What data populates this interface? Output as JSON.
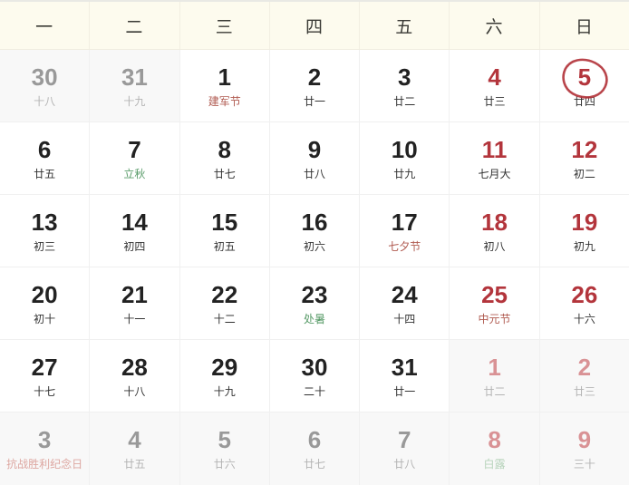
{
  "colors": {
    "header_bg": "#fdfbee",
    "cell_bg": "#ffffff",
    "other_month_bg": "#f8f8f8",
    "grid_line": "#f0f0f0",
    "number_default": "#222222",
    "number_weekend": "#b3353c",
    "number_other_month": "#999999",
    "number_other_month_weekend": "#d99295",
    "sub_default": "#333333",
    "sub_festival": "#b05a50",
    "sub_solar_term": "#5a9c6a",
    "marker_circle": "#b3353c"
  },
  "header": {
    "weekdays": [
      "一",
      "二",
      "三",
      "四",
      "五",
      "六",
      "日"
    ]
  },
  "marker": {
    "icon": "hand-drawn-circle-icon",
    "marked_day": "5",
    "color": "#b3353c"
  },
  "weeks": [
    {
      "days": [
        {
          "num": "30",
          "sub": "十八",
          "month": "other",
          "num_style": "muted",
          "sub_style": "muted",
          "marked": false
        },
        {
          "num": "31",
          "sub": "十九",
          "month": "other",
          "num_style": "muted",
          "sub_style": "muted",
          "marked": false
        },
        {
          "num": "1",
          "sub": "建军节",
          "month": "current",
          "num_style": "dark",
          "sub_style": "festival",
          "marked": false
        },
        {
          "num": "2",
          "sub": "廿一",
          "month": "current",
          "num_style": "dark",
          "sub_style": "normal",
          "marked": false
        },
        {
          "num": "3",
          "sub": "廿二",
          "month": "current",
          "num_style": "dark",
          "sub_style": "normal",
          "marked": false
        },
        {
          "num": "4",
          "sub": "廿三",
          "month": "current",
          "num_style": "weekend",
          "sub_style": "normal",
          "marked": false
        },
        {
          "num": "5",
          "sub": "廿四",
          "month": "current",
          "num_style": "weekend",
          "sub_style": "normal",
          "marked": true
        }
      ]
    },
    {
      "days": [
        {
          "num": "6",
          "sub": "廿五",
          "month": "current",
          "num_style": "dark",
          "sub_style": "normal",
          "marked": false
        },
        {
          "num": "7",
          "sub": "立秋",
          "month": "current",
          "num_style": "dark",
          "sub_style": "term",
          "marked": false
        },
        {
          "num": "8",
          "sub": "廿七",
          "month": "current",
          "num_style": "dark",
          "sub_style": "normal",
          "marked": false
        },
        {
          "num": "9",
          "sub": "廿八",
          "month": "current",
          "num_style": "dark",
          "sub_style": "normal",
          "marked": false
        },
        {
          "num": "10",
          "sub": "廿九",
          "month": "current",
          "num_style": "dark",
          "sub_style": "normal",
          "marked": false
        },
        {
          "num": "11",
          "sub": "七月大",
          "month": "current",
          "num_style": "weekend",
          "sub_style": "normal",
          "marked": false
        },
        {
          "num": "12",
          "sub": "初二",
          "month": "current",
          "num_style": "weekend",
          "sub_style": "normal",
          "marked": false
        }
      ]
    },
    {
      "days": [
        {
          "num": "13",
          "sub": "初三",
          "month": "current",
          "num_style": "dark",
          "sub_style": "normal",
          "marked": false
        },
        {
          "num": "14",
          "sub": "初四",
          "month": "current",
          "num_style": "dark",
          "sub_style": "normal",
          "marked": false
        },
        {
          "num": "15",
          "sub": "初五",
          "month": "current",
          "num_style": "dark",
          "sub_style": "normal",
          "marked": false
        },
        {
          "num": "16",
          "sub": "初六",
          "month": "current",
          "num_style": "dark",
          "sub_style": "normal",
          "marked": false
        },
        {
          "num": "17",
          "sub": "七夕节",
          "month": "current",
          "num_style": "dark",
          "sub_style": "festival",
          "marked": false
        },
        {
          "num": "18",
          "sub": "初八",
          "month": "current",
          "num_style": "weekend",
          "sub_style": "normal",
          "marked": false
        },
        {
          "num": "19",
          "sub": "初九",
          "month": "current",
          "num_style": "weekend",
          "sub_style": "normal",
          "marked": false
        }
      ]
    },
    {
      "days": [
        {
          "num": "20",
          "sub": "初十",
          "month": "current",
          "num_style": "dark",
          "sub_style": "normal",
          "marked": false
        },
        {
          "num": "21",
          "sub": "十一",
          "month": "current",
          "num_style": "dark",
          "sub_style": "normal",
          "marked": false
        },
        {
          "num": "22",
          "sub": "十二",
          "month": "current",
          "num_style": "dark",
          "sub_style": "normal",
          "marked": false
        },
        {
          "num": "23",
          "sub": "处暑",
          "month": "current",
          "num_style": "dark",
          "sub_style": "term",
          "marked": false
        },
        {
          "num": "24",
          "sub": "十四",
          "month": "current",
          "num_style": "dark",
          "sub_style": "normal",
          "marked": false
        },
        {
          "num": "25",
          "sub": "中元节",
          "month": "current",
          "num_style": "weekend",
          "sub_style": "festival",
          "marked": false
        },
        {
          "num": "26",
          "sub": "十六",
          "month": "current",
          "num_style": "weekend",
          "sub_style": "normal",
          "marked": false
        }
      ]
    },
    {
      "days": [
        {
          "num": "27",
          "sub": "十七",
          "month": "current",
          "num_style": "dark",
          "sub_style": "normal",
          "marked": false
        },
        {
          "num": "28",
          "sub": "十八",
          "month": "current",
          "num_style": "dark",
          "sub_style": "normal",
          "marked": false
        },
        {
          "num": "29",
          "sub": "十九",
          "month": "current",
          "num_style": "dark",
          "sub_style": "normal",
          "marked": false
        },
        {
          "num": "30",
          "sub": "二十",
          "month": "current",
          "num_style": "dark",
          "sub_style": "normal",
          "marked": false
        },
        {
          "num": "31",
          "sub": "廿一",
          "month": "current",
          "num_style": "dark",
          "sub_style": "normal",
          "marked": false
        },
        {
          "num": "1",
          "sub": "廿二",
          "month": "other",
          "num_style": "muted-red",
          "sub_style": "muted",
          "marked": false
        },
        {
          "num": "2",
          "sub": "廿三",
          "month": "other",
          "num_style": "muted-red",
          "sub_style": "muted",
          "marked": false
        }
      ]
    },
    {
      "days": [
        {
          "num": "3",
          "sub": "抗战胜利纪念日",
          "month": "other",
          "num_style": "muted",
          "sub_style": "muted-festival",
          "marked": false
        },
        {
          "num": "4",
          "sub": "廿五",
          "month": "other",
          "num_style": "muted",
          "sub_style": "muted",
          "marked": false
        },
        {
          "num": "5",
          "sub": "廿六",
          "month": "other",
          "num_style": "muted",
          "sub_style": "muted",
          "marked": false
        },
        {
          "num": "6",
          "sub": "廿七",
          "month": "other",
          "num_style": "muted",
          "sub_style": "muted",
          "marked": false
        },
        {
          "num": "7",
          "sub": "廿八",
          "month": "other",
          "num_style": "muted",
          "sub_style": "muted",
          "marked": false
        },
        {
          "num": "8",
          "sub": "白露",
          "month": "other",
          "num_style": "muted-red",
          "sub_style": "muted-term",
          "marked": false
        },
        {
          "num": "9",
          "sub": "三十",
          "month": "other",
          "num_style": "muted-red",
          "sub_style": "muted",
          "marked": false
        }
      ]
    }
  ]
}
